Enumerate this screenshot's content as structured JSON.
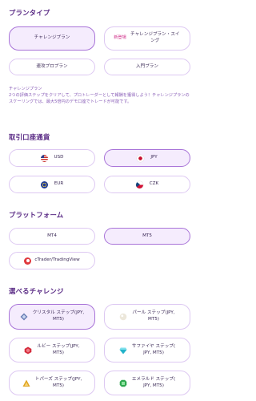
{
  "plan_type": {
    "title": "プランタイプ",
    "options": [
      {
        "label": "チャレンジプラン"
      },
      {
        "badge": "新登場",
        "label": "チャレンジプラン・スイング"
      },
      {
        "label": "速攻プロプラン"
      },
      {
        "label": "入門プラン"
      }
    ],
    "description_title": "チャレンジプラン",
    "description": "2つの評価ステップをクリアして、プロトレーダーとして報酬を獲得しよう！チャレンジプランのスケーリングでは、最大5倍円のデモ口座でトレードが可能です。"
  },
  "currency": {
    "title": "取引口座通貨",
    "options": [
      {
        "label": "USD",
        "icon": "us-flag-icon"
      },
      {
        "label": "JPY",
        "icon": "jp-flag-icon"
      },
      {
        "label": "EUR",
        "icon": "eu-flag-icon"
      },
      {
        "label": "CZK",
        "icon": "cz-flag-icon"
      }
    ]
  },
  "platform": {
    "title": "プラットフォーム",
    "options": [
      {
        "label": "MT4"
      },
      {
        "label": "MT5"
      },
      {
        "label": "cTrader/TradingView",
        "icon": "ctrader-icon"
      }
    ]
  },
  "challenge": {
    "title": "選べるチャレンジ",
    "options": [
      {
        "line1": "クリスタル ステップ(JPY,",
        "line2": "MT5)",
        "icon": "crystal-gem-icon"
      },
      {
        "line1": "パール ステップ(JPY,",
        "line2": "MT5)",
        "icon": "pearl-gem-icon"
      },
      {
        "line1": "ルビー ステップ(JPY,",
        "line2": "MT5)",
        "icon": "ruby-gem-icon"
      },
      {
        "line1": "サファイヤ ステップ(",
        "line2": "JPY, MT5)",
        "icon": "sapphire-gem-icon"
      },
      {
        "line1": "トパーズ ステップ(JPY,",
        "line2": "MT5)",
        "icon": "topaz-gem-icon"
      },
      {
        "line1": "エメラルド ステップ(",
        "line2": "JPY, MT5)",
        "icon": "emerald-gem-icon"
      }
    ]
  },
  "colors": {
    "accent": "#a873d8",
    "heading": "#5b2c86",
    "selected_bg": "#f5ecfd"
  }
}
